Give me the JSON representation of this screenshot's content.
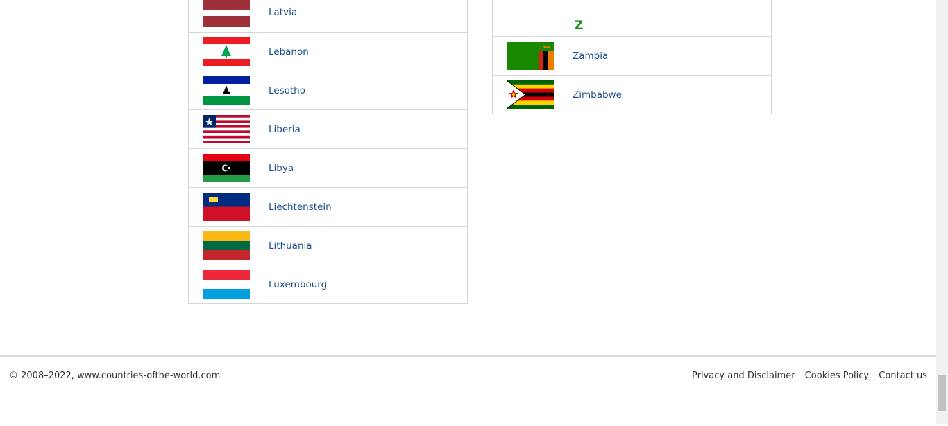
{
  "left_countries": [
    {
      "name": "Latvia",
      "flag_icon": "latvia-flag"
    },
    {
      "name": "Lebanon",
      "flag_icon": "lebanon-flag"
    },
    {
      "name": "Lesotho",
      "flag_icon": "lesotho-flag"
    },
    {
      "name": "Liberia",
      "flag_icon": "liberia-flag"
    },
    {
      "name": "Libya",
      "flag_icon": "libya-flag"
    },
    {
      "name": "Liechtenstein",
      "flag_icon": "liechtenstein-flag"
    },
    {
      "name": "Lithuania",
      "flag_icon": "lithuania-flag"
    },
    {
      "name": "Luxembourg",
      "flag_icon": "luxembourg-flag"
    }
  ],
  "right_section": {
    "letter": "Z",
    "countries": [
      {
        "name": "Zambia",
        "flag_icon": "zambia-flag"
      },
      {
        "name": "Zimbabwe",
        "flag_icon": "zimbabwe-flag"
      }
    ]
  },
  "footer": {
    "copyright": "© 2008–2022, www.countries-ofthe-world.com",
    "links": [
      "Privacy and Disclaimer",
      "Cookies Policy",
      "Contact us"
    ]
  },
  "colors": {
    "link": "#1a4f8b",
    "letter_heading": "#1b8a1b",
    "border": "#d6d6d6"
  }
}
